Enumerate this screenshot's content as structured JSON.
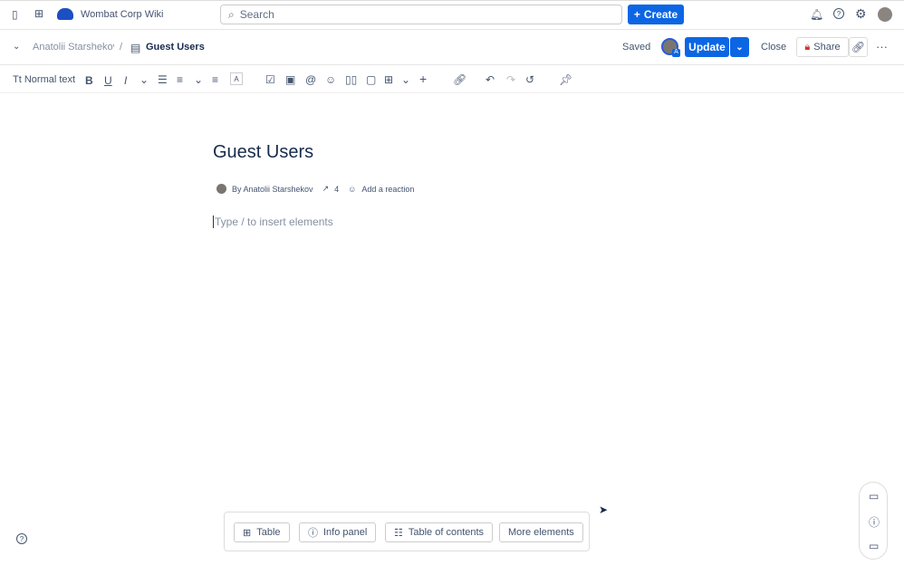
{
  "app": {
    "title": "Wombat Corp Wiki",
    "search_placeholder": "Search",
    "create_label": "Create"
  },
  "breadcrumb": {
    "parent": "Anatolii Starshekov",
    "current": "Guest Users"
  },
  "actions": {
    "status": "Saved",
    "update": "Update",
    "close": "Close",
    "share": "Share",
    "avatar_badge": "A"
  },
  "toolbar": {
    "text_style": "Normal text",
    "bold": "B",
    "underline": "U",
    "italic": "I"
  },
  "page": {
    "title": "Guest Users",
    "byline": "By Anatolii Starshekov",
    "views": "4",
    "reaction": "Add a reaction",
    "placeholder": "Type / to insert elements"
  },
  "insert_bar": {
    "table": "Table",
    "info_panel": "Info panel",
    "toc": "Table of contents",
    "more": "More elements"
  }
}
